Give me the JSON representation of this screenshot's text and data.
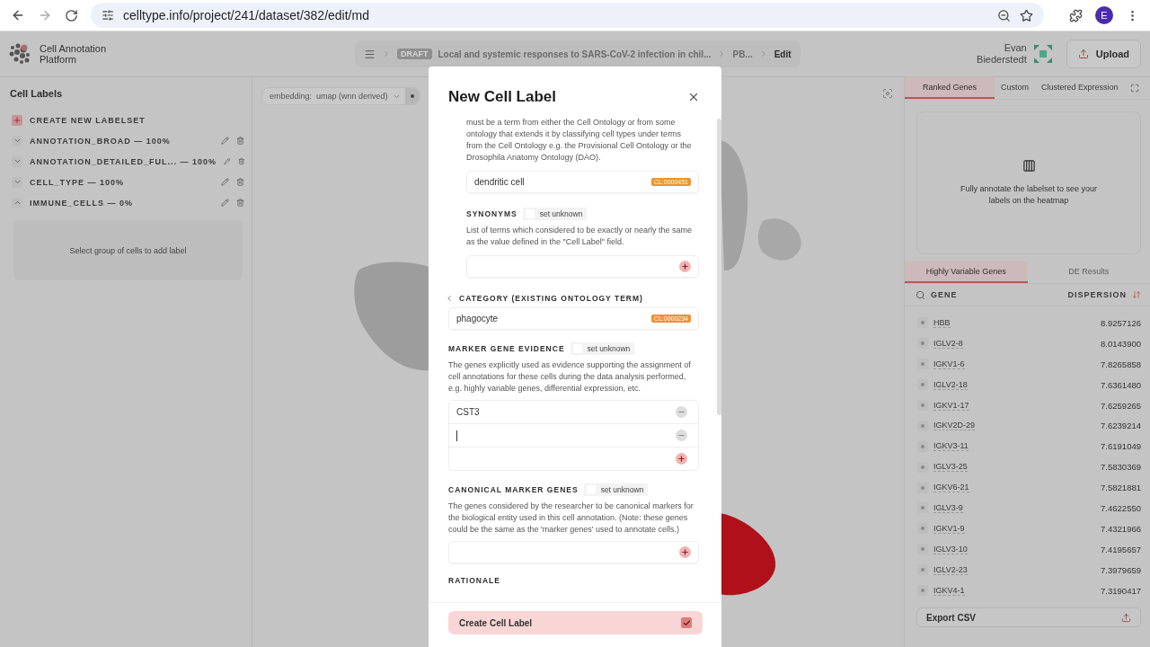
{
  "browser": {
    "url": "celltype.info/project/241/dataset/382/edit/md",
    "profile_initial": "E"
  },
  "header": {
    "app_name": "Cell Annotation Platform",
    "draft_badge": "DRAFT",
    "breadcrumb": [
      "Local and systemic responses to SARS-CoV-2 infection in chil...",
      "PB...",
      "Edit"
    ],
    "user_name": "Evan Biederstedt",
    "upload_button": "Upload"
  },
  "sidebar": {
    "title": "Cell Labels",
    "create_button": "CREATE NEW LABELSET",
    "labelsets": [
      {
        "name": "ANNOTATION_BROAD — 100%",
        "expanded": false
      },
      {
        "name": "ANNOTATION_DETAILED_FUL... — 100%",
        "expanded": false
      },
      {
        "name": "CELL_TYPE — 100%",
        "expanded": false
      },
      {
        "name": "IMMUNE_CELLS — 0%",
        "expanded": true
      }
    ],
    "empty_hint": "Select group of cells to add label"
  },
  "canvas": {
    "embedding_label": "embedding:",
    "embedding_value": "umap (wnn derived)"
  },
  "modal": {
    "title": "New Cell Label",
    "cell_label_description": "must be a term from either the Cell Ontology or from some ontology that extends it by classifying cell types under terms from the Cell Ontology e.g. the Provisional Cell Ontology or the Drosophila Anatomy Ontology (DAO).",
    "cell_label": {
      "value": "dendritic cell",
      "badge": "CL:0000451"
    },
    "synonyms": {
      "title": "SYNONYMS",
      "unknown_label": "set unknown",
      "unknown_checked": false,
      "description": "List of terms which considered to be exactly or nearly the same as the value defined in the \"Cell Label\" field."
    },
    "category": {
      "title": "CATEGORY (EXISTING ONTOLOGY TERM)",
      "value": "phagocyte",
      "badge": "CL:0000234"
    },
    "marker_genes": {
      "title": "MARKER GENE EVIDENCE",
      "unknown_label": "set unknown",
      "unknown_checked": false,
      "description": "The genes explicitly used as evidence supporting the assignment of cell annotations for these cells during the data analysis performed, e.g. highly variable genes, differential expression, etc.",
      "genes": [
        {
          "value": "CST3",
          "focused": false
        },
        {
          "focused": true
        }
      ]
    },
    "canonical_markers": {
      "title": "CANONICAL MARKER GENES",
      "unknown_label": "set unknown",
      "unknown_checked": false,
      "description": "The genes considered by the researcher to be canonical markers for the biological entity used in this cell annotation. (Note: these genes could be the same as the 'marker genes' used to annotate cells.)"
    },
    "rationale_title": "RATIONALE",
    "create_button": "Create Cell Label"
  },
  "right_panel": {
    "tabs": [
      {
        "label": "Ranked Genes",
        "selected": true
      },
      {
        "label": "Custom",
        "selected": false
      },
      {
        "label": "Clustered Expression",
        "selected": false
      }
    ],
    "heatmap_hint": "Fully annotate the labelset to see your labels on the heatmap",
    "gene_tabs": [
      {
        "label": "Highly Variable Genes",
        "selected": true
      },
      {
        "label": "DE Results",
        "selected": false
      }
    ],
    "columns": {
      "gene": "GENE",
      "dispersion": "DISPERSION"
    },
    "rows": [
      {
        "gene": "HBB",
        "dispersion": "8.9257126"
      },
      {
        "gene": "IGLV2-8",
        "dispersion": "8.0143900"
      },
      {
        "gene": "IGKV1-6",
        "dispersion": "7.8265858"
      },
      {
        "gene": "IGLV2-18",
        "dispersion": "7.6361480"
      },
      {
        "gene": "IGKV1-17",
        "dispersion": "7.6259265"
      },
      {
        "gene": "IGKV2D-29",
        "dispersion": "7.6239214"
      },
      {
        "gene": "IGKV3-11",
        "dispersion": "7.6191049"
      },
      {
        "gene": "IGLV3-25",
        "dispersion": "7.5830369"
      },
      {
        "gene": "IGKV6-21",
        "dispersion": "7.5821881"
      },
      {
        "gene": "IGLV3-9",
        "dispersion": "7.4622550"
      },
      {
        "gene": "IGKV1-9",
        "dispersion": "7.4321966"
      },
      {
        "gene": "IGLV3-10",
        "dispersion": "7.4195657"
      },
      {
        "gene": "IGLV2-23",
        "dispersion": "7.3979659"
      },
      {
        "gene": "IGKV4-1",
        "dispersion": "7.3190417"
      }
    ],
    "export_button": "Export CSV"
  }
}
